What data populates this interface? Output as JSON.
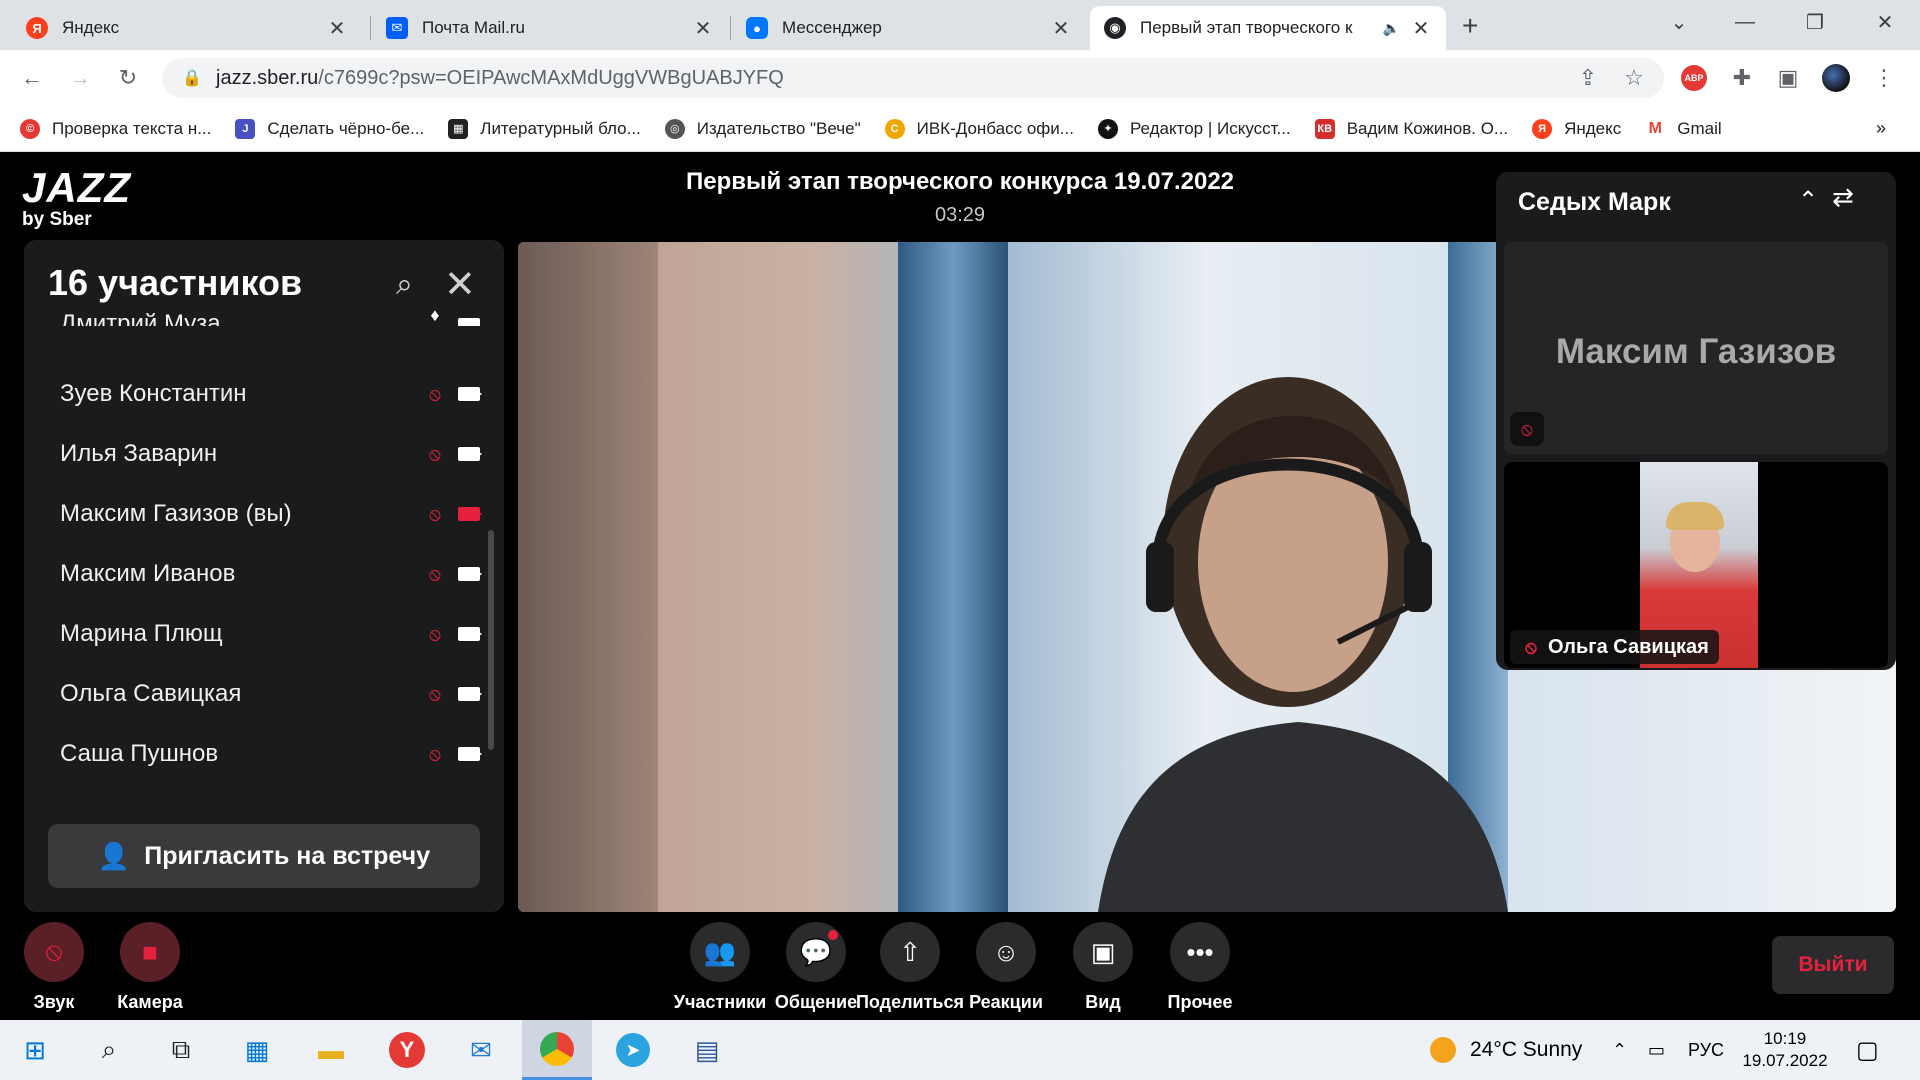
{
  "browser": {
    "tabs": [
      {
        "title": "Яндекс",
        "icon": "yandex-icon",
        "color": "#fc3f1d"
      },
      {
        "title": "Почта Mail.ru",
        "icon": "mail-icon",
        "color": "#005ff9"
      },
      {
        "title": "Мессенджер",
        "icon": "messenger-icon",
        "color": "#0077ff"
      },
      {
        "title": "Первый этап творческого к",
        "icon": "jazz-icon",
        "color": "#202124"
      }
    ],
    "url_host": "jazz.sber.ru",
    "url_path": "/c7699c?psw=OEIPAwcMAxMdUggVWBgUABJYFQ",
    "bookmarks": [
      {
        "label": "Проверка текста н...",
        "color": "#e53935"
      },
      {
        "label": "Сделать чёрно-бе...",
        "color": "#4a4fc4"
      },
      {
        "label": "Литературный бло...",
        "color": "#222222"
      },
      {
        "label": "Издательство \"Вече\"",
        "color": "#555555"
      },
      {
        "label": "ИВК-Донбасс офи...",
        "color": "#f0a500"
      },
      {
        "label": "Редактор | Искусст...",
        "color": "#111111"
      },
      {
        "label": "Вадим Кожинов. О...",
        "color": "#d32f2f"
      },
      {
        "label": "Яндекс",
        "color": "#fc3f1d"
      },
      {
        "label": "Gmail",
        "color": "#ea4335"
      }
    ]
  },
  "app": {
    "logo_big": "JAZZ",
    "logo_small": "by Sber",
    "meeting_title": "Первый этап творческого конкурса 19.07.2022",
    "timer": "03:29",
    "participants": {
      "title": "16 участников",
      "items": [
        {
          "name": "Дмитрий Муза",
          "cam_off": false
        },
        {
          "name": "Зуев Константин",
          "cam_off": false
        },
        {
          "name": "Илья Заварин",
          "cam_off": false
        },
        {
          "name": "Максим Газизов (вы)",
          "cam_off": true
        },
        {
          "name": "Максим Иванов",
          "cam_off": false
        },
        {
          "name": "Марина Плющ",
          "cam_off": false
        },
        {
          "name": "Ольга Савицкая",
          "cam_off": false
        },
        {
          "name": "Саша Пушнов",
          "cam_off": false
        }
      ],
      "invite_label": "Пригласить на встречу"
    },
    "side_panel": {
      "name": "Седых Марк",
      "tile1_name": "Максим Газизов",
      "tile2_name": "Ольга Савицкая"
    },
    "controls": {
      "sound": "Звук",
      "camera": "Камера",
      "participants": "Участники",
      "chat": "Общение",
      "share": "Поделиться",
      "reactions": "Реакции",
      "view": "Вид",
      "more": "Прочее",
      "leave": "Выйти"
    }
  },
  "taskbar": {
    "weather": "24°C  Sunny",
    "lang": "РУС",
    "time": "10:19",
    "date": "19.07.2022"
  }
}
